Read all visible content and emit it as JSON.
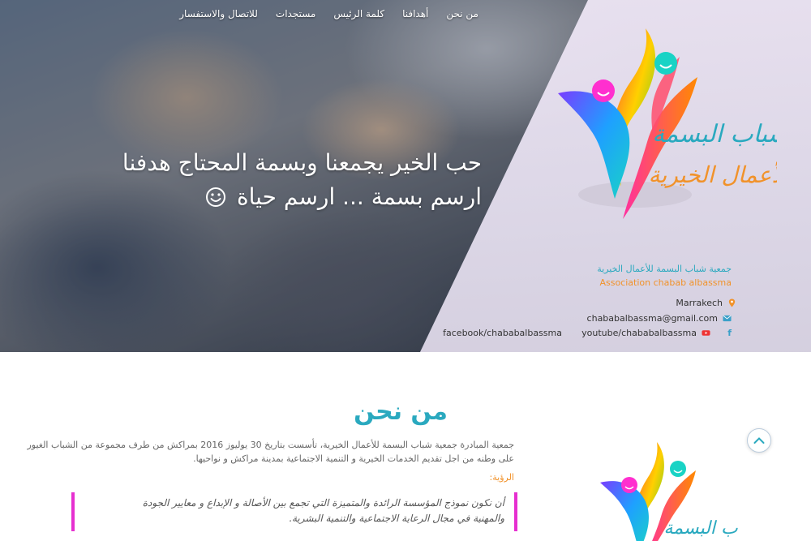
{
  "nav": {
    "items": [
      {
        "label": "من نحن"
      },
      {
        "label": "أهدافنا"
      },
      {
        "label": "كلمة الرئيس"
      },
      {
        "label": "مستجدات"
      },
      {
        "label": "للاتصال والاستفسار"
      }
    ]
  },
  "hero": {
    "line1": "حب الخير يجمعنا وبسمة المحتاج هدفنا",
    "line2": "ارسم بسمة ... ارسم حياة",
    "logo_text_top": "شباب البسمة",
    "logo_text_bottom": "للأعمال الخيرية"
  },
  "org": {
    "name_ar": "جمعية شباب البسمة للأعمال الخيرية",
    "name_en": "Association chabab albassma"
  },
  "contact": {
    "city": "Marrakech",
    "email": "chababalbassma@gmail.com",
    "youtube": "youtube/chababalbassma",
    "facebook": "facebook/chababalbassma",
    "icons": [
      "map-marker-icon",
      "envelope-icon",
      "youtube-icon",
      "facebook-icon"
    ]
  },
  "about": {
    "title": "من نحن",
    "text": "جمعية المبادرة جمعية شباب البسمة للأعمال الخيرية، تأسست بتاريخ 30 يوليوز 2016 بمراكش من طرف مجموعة من الشباب الغيور على وطنه من اجل تقديم الخدمات الخيرية و التنمية الاجتماعية بمدينة مراكش و نواحيها.",
    "vision_label": "الرؤية:",
    "vision_line1": "أن نكون نموذج المؤسسة الرائدة والمتميزة التي تجمع بين الأصالة و الإبداع و معايير الجودة",
    "vision_line2": "والمهنية في مجال الرعاية الاجتماعية والتنمية البشرية."
  },
  "colors": {
    "accent": "#2aa9bf",
    "orange": "#f1922a",
    "magenta": "#e62fd0"
  }
}
